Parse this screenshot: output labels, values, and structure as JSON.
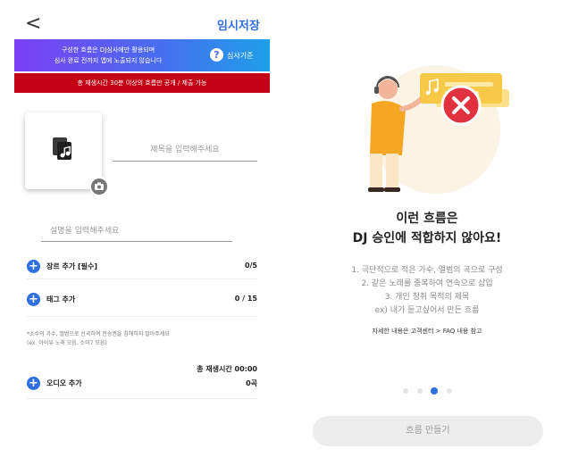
{
  "header": {
    "back_label": "<",
    "save_label": "임시저장"
  },
  "banner": {
    "line1": "구성한 흐름은 DJ심사에만 활용되며",
    "line2": "심사 완료 전까지 앱에 노출되지 않습니다",
    "help_mark": "?",
    "help_label": "심사기준",
    "red_notice": "총 재생시간 30분 이상의 흐름만 공개 / 제출 가능"
  },
  "form": {
    "title_placeholder": "제목을 입력해주세요",
    "description_placeholder": "설명을 입력해주세요"
  },
  "rows": {
    "genre": {
      "label": "장르 추가 [필수]",
      "count": "0/5"
    },
    "tag": {
      "label": "태그 추가",
      "count": "0 / 15"
    },
    "audio": {
      "label": "오디오 추가",
      "count": "0곡"
    }
  },
  "notice": {
    "line1": "*소수의 가수, 앨범으로 선곡하여 전송권을 침해하지 말아주세요",
    "line2": "(ex. 아이유 노래 모음, 소미7 모음)"
  },
  "total_time": "총 재생시간 00:00",
  "onboarding": {
    "headline1": "이런 흐름은",
    "headline2": "DJ 승인에 적합하지 않아요!",
    "rules": [
      "1. 극단적으로 적은 가수, 앨범의 곡으로 구성",
      "2. 같은 노래를 중복하여 연속으로 삽입",
      "3. 개인 청취 목적의 제목",
      "ex) 내가 듣고싶어서 만든 흐름"
    ],
    "help_text": "자세한 내용은 고객센터 > FAQ 내용 참고",
    "page_count": 4,
    "active_page": 3,
    "button_label": "흐름 만들기"
  },
  "colors": {
    "accent": "#2f6fe0",
    "red_banner": "#c40014",
    "x_mark": "#e0313f"
  },
  "icons": [
    "back-chevron-icon",
    "question-icon",
    "music-doc-icon",
    "camera-icon",
    "plus-icon",
    "error-x-icon",
    "music-note-icon"
  ]
}
